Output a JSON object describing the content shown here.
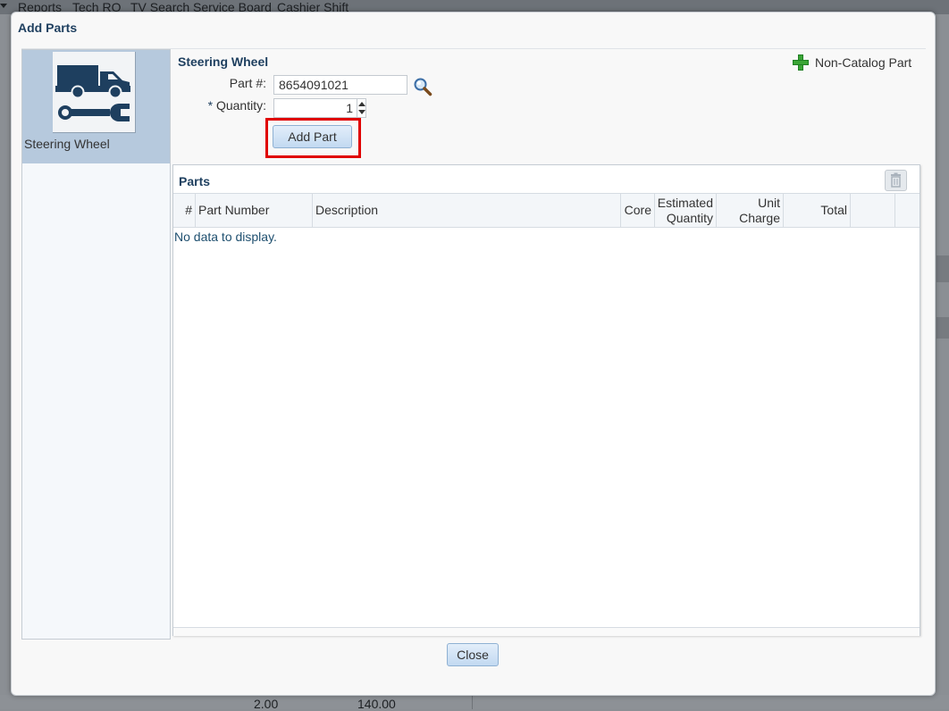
{
  "background": {
    "menu": [
      "Reports",
      "Tech RO",
      "TV Search Service Board",
      "Cashier Shift"
    ],
    "values": [
      "2.00",
      "140.00"
    ]
  },
  "dialog": {
    "title": "Add Parts",
    "category": {
      "label": "Steering Wheel",
      "icon": "truck-wrench-icon"
    },
    "section_title": "Steering Wheel",
    "non_catalog_label": "Non-Catalog Part",
    "form": {
      "part_label": "Part #:",
      "part_value": "8654091021",
      "qty_required_mark": "*",
      "qty_label": "Quantity:",
      "qty_value": "1",
      "add_button": "Add Part"
    },
    "parts": {
      "title": "Parts",
      "columns": [
        {
          "key": "num",
          "label": "#"
        },
        {
          "key": "part_number",
          "label": "Part Number"
        },
        {
          "key": "description",
          "label": "Description"
        },
        {
          "key": "core",
          "label": "Core"
        },
        {
          "key": "est_qty",
          "label": "Estimated Quantity"
        },
        {
          "key": "unit_charge",
          "label": "Unit Charge"
        },
        {
          "key": "total",
          "label": "Total"
        },
        {
          "key": "blank",
          "label": ""
        }
      ],
      "empty_text": "No data to display."
    },
    "close_button": "Close",
    "colors": {
      "accent": "#1e3f5f",
      "highlight": "#e00000",
      "selected": "#b6c9dd"
    }
  }
}
